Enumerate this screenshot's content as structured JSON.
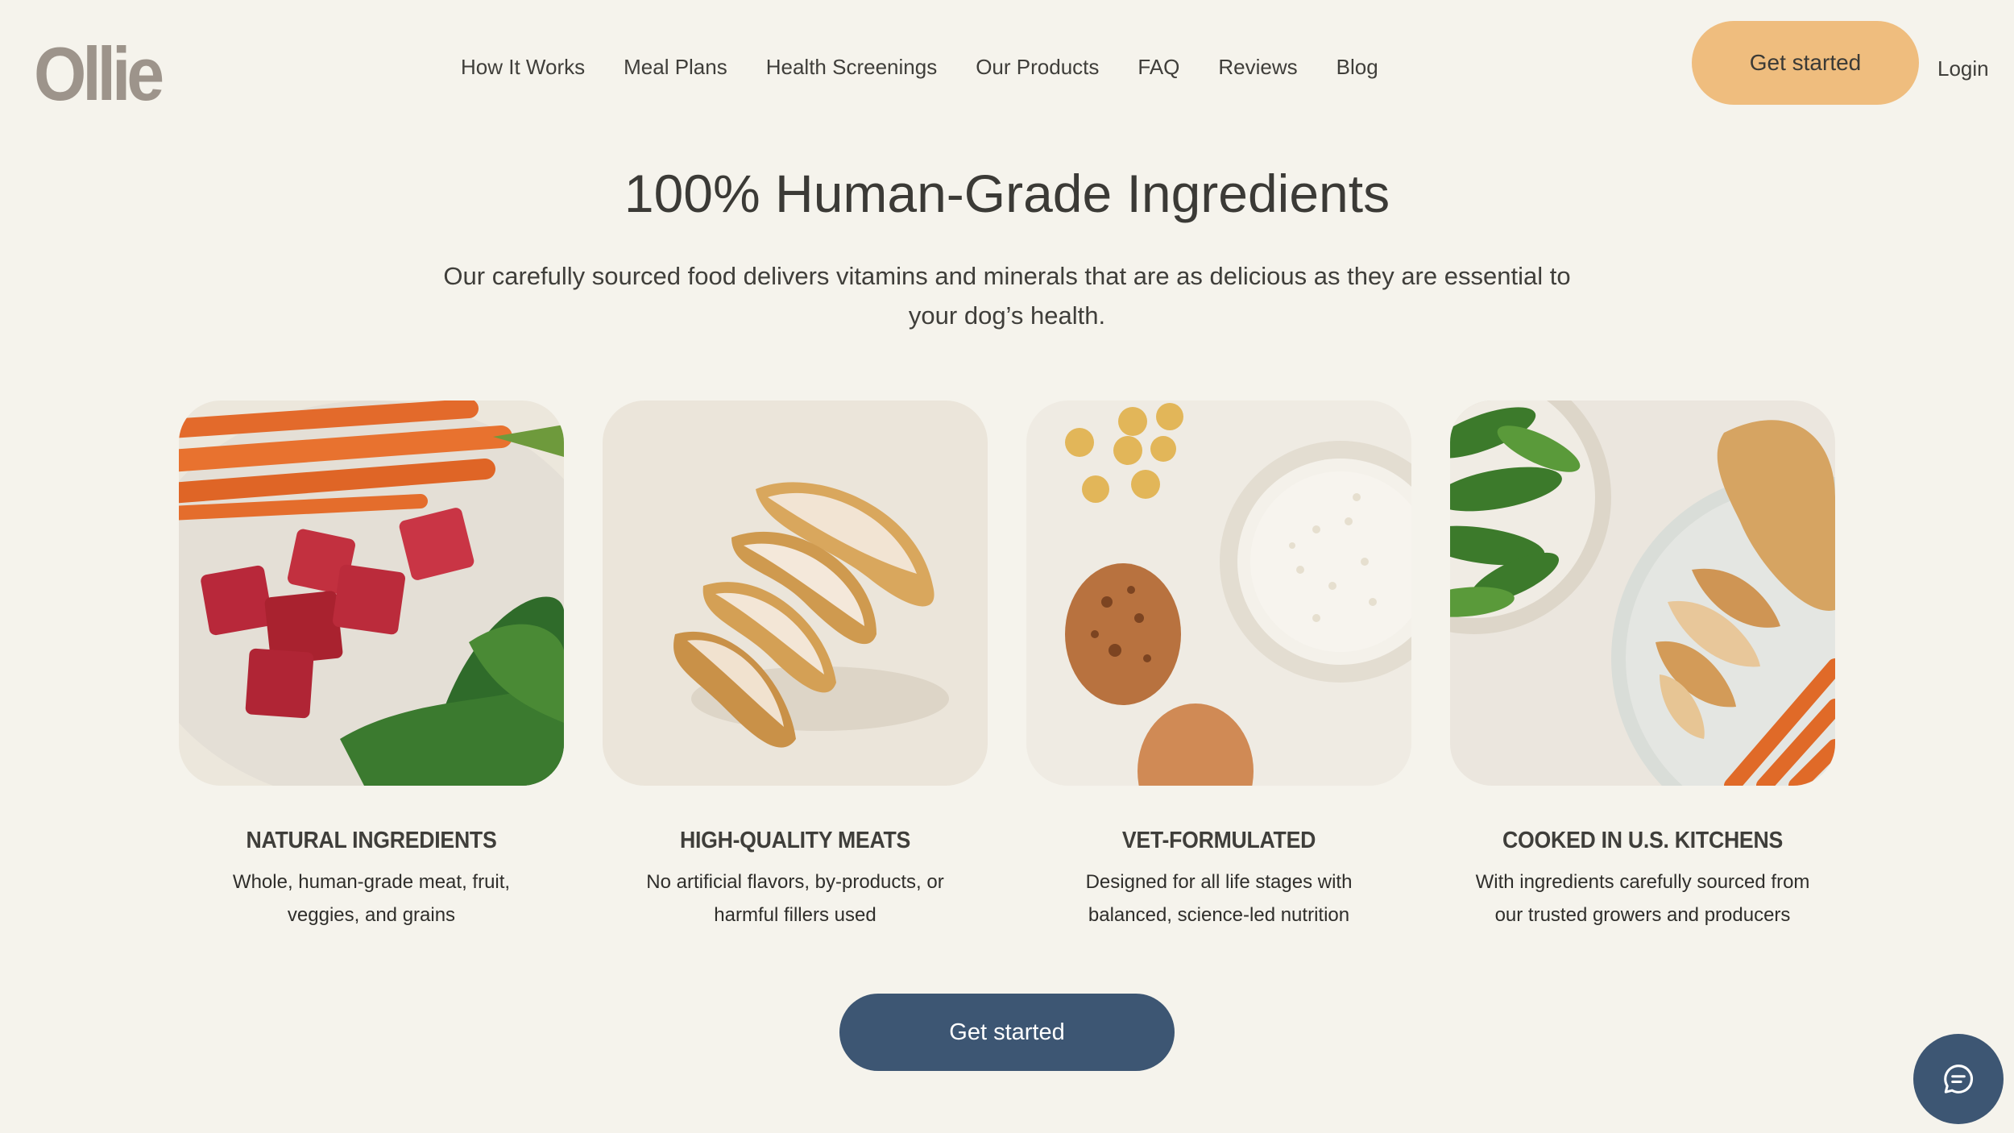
{
  "brand": {
    "logo": "Ollie"
  },
  "nav": {
    "items": [
      "How It Works",
      "Meal Plans",
      "Health Screenings",
      "Our Products",
      "FAQ",
      "Reviews",
      "Blog"
    ]
  },
  "header": {
    "cta_label": "Get started",
    "login_label": "Login"
  },
  "hero": {
    "title": "100% Human-Grade Ingredients",
    "subtitle_line1": "Our carefully sourced food delivers vitamins and minerals that are as delicious as they are essential to",
    "subtitle_line2": "your dog’s health."
  },
  "cards": [
    {
      "image": "beef-carrots-spinach-photo",
      "title": "NATURAL INGREDIENTS",
      "desc_line1": "Whole, human-grade meat, fruit,",
      "desc_line2": "veggies, and grains"
    },
    {
      "image": "sliced-chicken-photo",
      "title": "HIGH-QUALITY MEATS",
      "desc_line1": "No artificial flavors, by-products, or",
      "desc_line2": "harmful fillers used"
    },
    {
      "image": "eggs-chickpeas-rice-photo",
      "title": "VET-FORMULATED",
      "desc_line1": "Designed for all life stages with",
      "desc_line2": "balanced, science-led nutrition"
    },
    {
      "image": "chicken-peas-carrots-photo",
      "title": "COOKED IN U.S. KITCHENS",
      "desc_line1": "With ingredients carefully sourced from",
      "desc_line2": "our trusted growers and producers"
    }
  ],
  "cta": {
    "label": "Get started"
  },
  "chat": {
    "icon": "chat-bubble-icon"
  },
  "colors": {
    "background": "#f5f3ec",
    "accent_orange": "#efbd7e",
    "accent_navy": "#3d5673",
    "logo": "#9d948b"
  }
}
